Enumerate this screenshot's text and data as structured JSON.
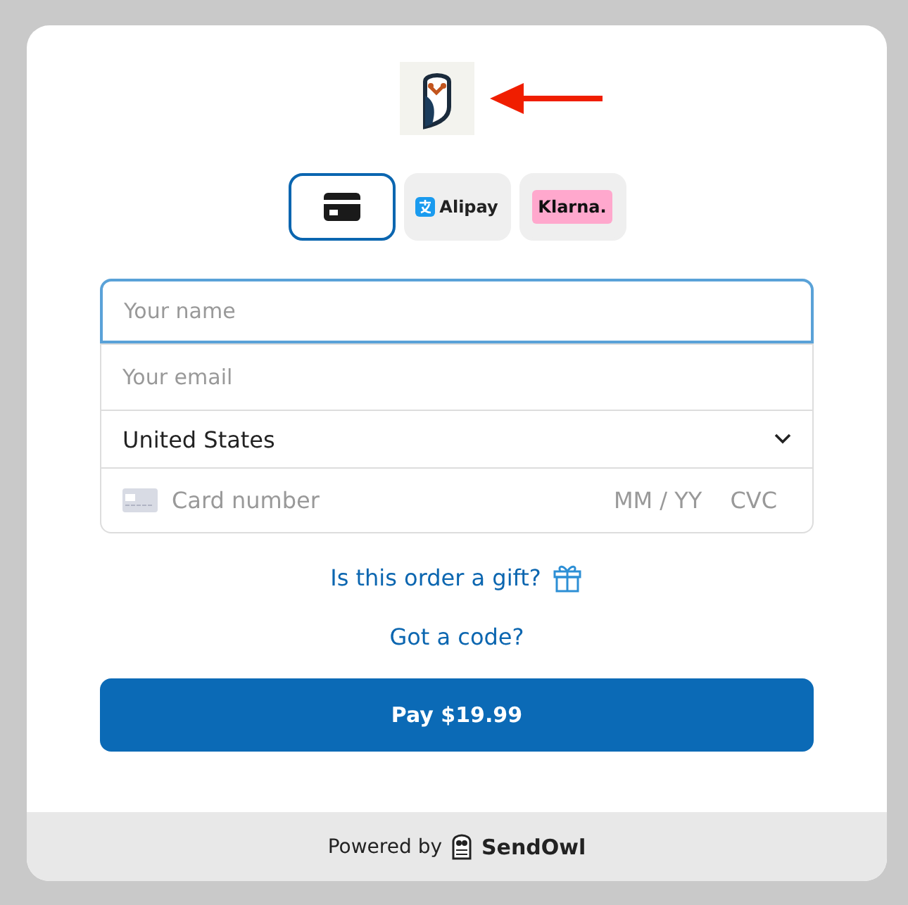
{
  "payment_methods": [
    {
      "kind": "card",
      "selected": true
    },
    {
      "kind": "alipay",
      "label": "Alipay",
      "selected": false
    },
    {
      "kind": "klarna",
      "label": "Klarna.",
      "selected": false
    }
  ],
  "name_field": {
    "placeholder": "Your name",
    "focused": true
  },
  "email_field": {
    "placeholder": "Your email"
  },
  "country_select": {
    "value": "United States"
  },
  "card_field": {
    "placeholder": "Card number",
    "expiry_placeholder": "MM / YY",
    "cvc_placeholder": "CVC"
  },
  "gift_link": "Is this order a gift?",
  "code_link": "Got a code?",
  "pay_button": "Pay $19.99",
  "footer": {
    "text": "Powered by",
    "brand": "SendOwl"
  }
}
